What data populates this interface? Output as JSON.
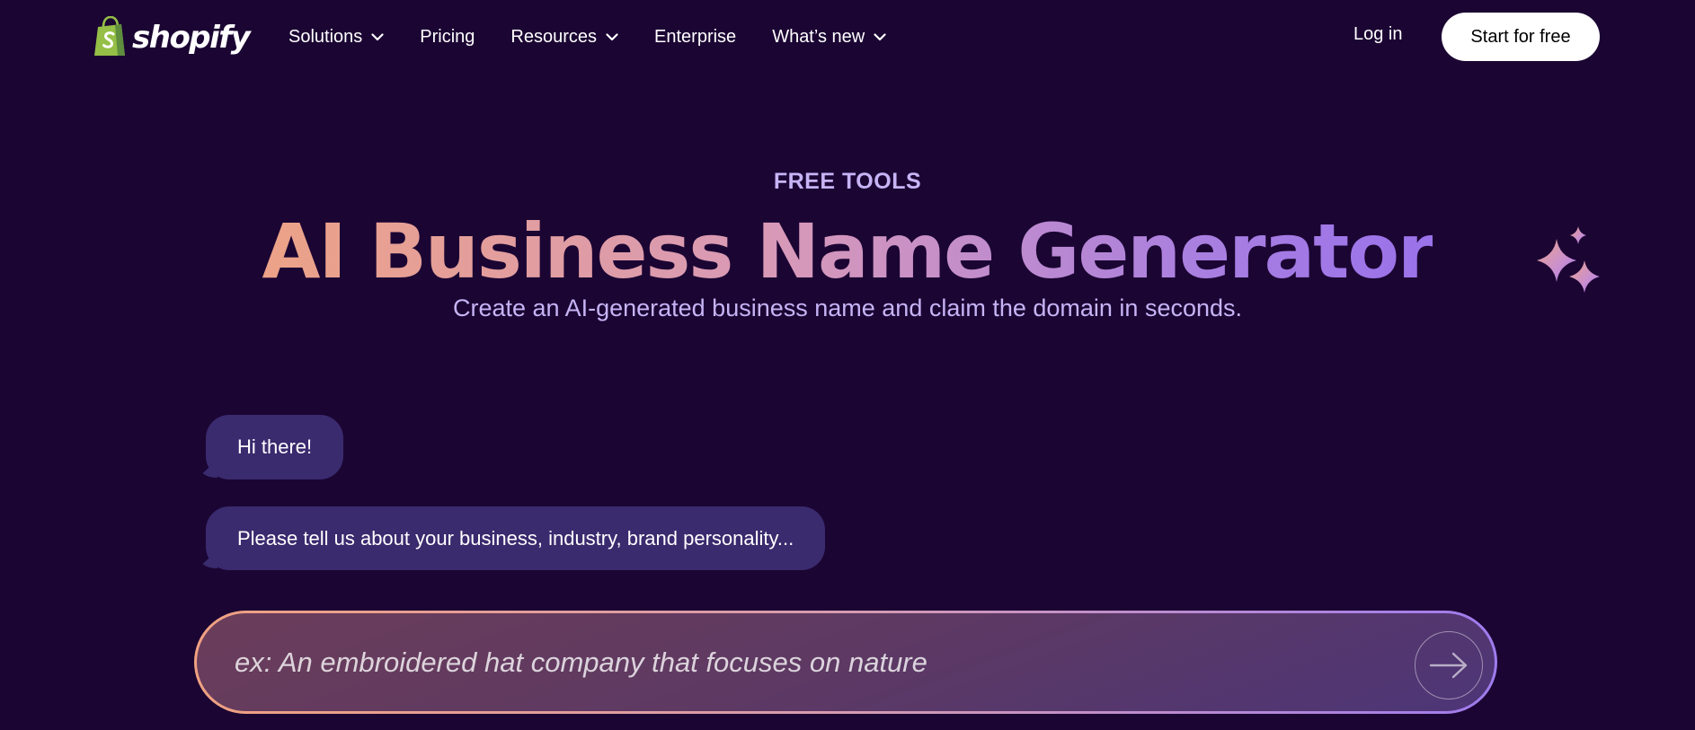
{
  "brand": {
    "name": "shopify",
    "logo_color": "#95bf47"
  },
  "nav": {
    "items": [
      {
        "label": "Solutions",
        "has_dropdown": true
      },
      {
        "label": "Pricing",
        "has_dropdown": false
      },
      {
        "label": "Resources",
        "has_dropdown": true
      },
      {
        "label": "Enterprise",
        "has_dropdown": false
      },
      {
        "label": "What’s new",
        "has_dropdown": true
      }
    ],
    "login_label": "Log in",
    "cta_label": "Start for free"
  },
  "hero": {
    "eyebrow": "FREE TOOLS",
    "title": "AI Business Name Generator",
    "subtitle": "Create an AI-generated business name and claim the domain in seconds.",
    "decoration_icon": "sparkles-icon"
  },
  "chat": {
    "messages": [
      {
        "text": "Hi there!"
      },
      {
        "text": "Please tell us about your business, industry, brand personality..."
      }
    ],
    "input": {
      "value": "",
      "placeholder": "ex: An embroidered hat company that focuses on nature"
    },
    "send_icon": "arrow-right-icon"
  },
  "colors": {
    "background": "#1b0533",
    "accent_text": "#c6b4f5",
    "bubble": "#3a2a6e",
    "gradient_start": "#eca287",
    "gradient_end": "#9a72ea"
  }
}
